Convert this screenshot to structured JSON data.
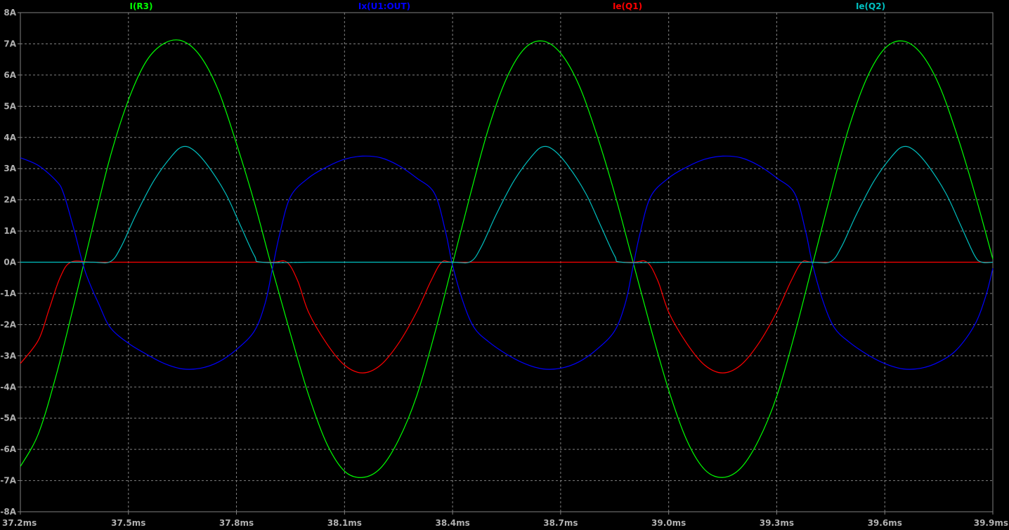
{
  "chart_data": {
    "type": "line",
    "background": "#000000",
    "grid": true,
    "grid_color": "#808080",
    "axis_color": "#808080",
    "tick_label_color": "#b0b0b0",
    "legend_placement": "top",
    "xlim": [
      37.2,
      39.9
    ],
    "ylim": [
      -8,
      8
    ],
    "x_unit": "ms",
    "y_unit": "A",
    "x_ticks": [
      "37.2ms",
      "37.5ms",
      "37.8ms",
      "38.1ms",
      "38.4ms",
      "38.7ms",
      "39.0ms",
      "39.3ms",
      "39.6ms",
      "39.9ms"
    ],
    "y_ticks": [
      "8A",
      "7A",
      "6A",
      "5A",
      "4A",
      "3A",
      "2A",
      "1A",
      "0A",
      "-1A",
      "-2A",
      "-3A",
      "-4A",
      "-5A",
      "-6A",
      "-7A",
      "-8A"
    ],
    "series": [
      {
        "name": "I(R3)",
        "color": "#00ff00",
        "points": [
          [
            37.2,
            -6.55
          ],
          [
            37.25,
            -5.5
          ],
          [
            37.3,
            -3.6
          ],
          [
            37.35,
            -1.3
          ],
          [
            37.4,
            1.1
          ],
          [
            37.45,
            3.4
          ],
          [
            37.5,
            5.2
          ],
          [
            37.55,
            6.45
          ],
          [
            37.6,
            7.02
          ],
          [
            37.65,
            7.09
          ],
          [
            37.7,
            6.6
          ],
          [
            37.75,
            5.5
          ],
          [
            37.8,
            3.8
          ],
          [
            37.85,
            1.9
          ],
          [
            37.9,
            -0.25
          ],
          [
            37.95,
            -2.3
          ],
          [
            38.0,
            -4.25
          ],
          [
            38.05,
            -5.8
          ],
          [
            38.1,
            -6.7
          ],
          [
            38.15,
            -6.9
          ],
          [
            38.2,
            -6.6
          ],
          [
            38.25,
            -5.7
          ],
          [
            38.3,
            -4.3
          ],
          [
            38.35,
            -2.3
          ],
          [
            38.4,
            -0.05
          ],
          [
            38.45,
            2.2
          ],
          [
            38.5,
            4.3
          ],
          [
            38.55,
            5.9
          ],
          [
            38.6,
            6.85
          ],
          [
            38.65,
            7.09
          ],
          [
            38.7,
            6.7
          ],
          [
            38.75,
            5.7
          ],
          [
            38.8,
            4.1
          ],
          [
            38.85,
            2.2
          ],
          [
            38.9,
            0.05
          ],
          [
            38.95,
            -2.1
          ],
          [
            39.0,
            -4.1
          ],
          [
            39.05,
            -5.7
          ],
          [
            39.1,
            -6.65
          ],
          [
            39.15,
            -6.9
          ],
          [
            39.2,
            -6.6
          ],
          [
            39.25,
            -5.7
          ],
          [
            39.3,
            -4.3
          ],
          [
            39.35,
            -2.3
          ],
          [
            39.4,
            -0.05
          ],
          [
            39.45,
            2.2
          ],
          [
            39.5,
            4.3
          ],
          [
            39.55,
            5.9
          ],
          [
            39.6,
            6.85
          ],
          [
            39.65,
            7.09
          ],
          [
            39.7,
            6.7
          ],
          [
            39.75,
            5.7
          ],
          [
            39.8,
            4.1
          ],
          [
            39.85,
            2.2
          ],
          [
            39.9,
            0.1
          ]
        ]
      },
      {
        "name": "Ix(U1:OUT)",
        "color": "#0000ff",
        "points": [
          [
            37.2,
            3.35
          ],
          [
            37.25,
            3.1
          ],
          [
            37.3,
            2.6
          ],
          [
            37.32,
            2.2
          ],
          [
            37.35,
            1.0
          ],
          [
            37.38,
            -0.3
          ],
          [
            37.42,
            -1.4
          ],
          [
            37.45,
            -2.1
          ],
          [
            37.5,
            -2.6
          ],
          [
            37.55,
            -2.95
          ],
          [
            37.6,
            -3.25
          ],
          [
            37.65,
            -3.42
          ],
          [
            37.7,
            -3.4
          ],
          [
            37.75,
            -3.2
          ],
          [
            37.8,
            -2.8
          ],
          [
            37.85,
            -2.2
          ],
          [
            37.88,
            -1.3
          ],
          [
            37.9,
            -0.2
          ],
          [
            37.92,
            0.9
          ],
          [
            37.95,
            2.1
          ],
          [
            38.0,
            2.7
          ],
          [
            38.05,
            3.05
          ],
          [
            38.1,
            3.3
          ],
          [
            38.15,
            3.4
          ],
          [
            38.2,
            3.35
          ],
          [
            38.25,
            3.1
          ],
          [
            38.3,
            2.7
          ],
          [
            38.35,
            2.2
          ],
          [
            38.38,
            1.0
          ],
          [
            38.4,
            -0.1
          ],
          [
            38.43,
            -1.3
          ],
          [
            38.46,
            -2.1
          ],
          [
            38.5,
            -2.55
          ],
          [
            38.55,
            -2.95
          ],
          [
            38.6,
            -3.25
          ],
          [
            38.65,
            -3.42
          ],
          [
            38.7,
            -3.4
          ],
          [
            38.75,
            -3.2
          ],
          [
            38.8,
            -2.8
          ],
          [
            38.85,
            -2.2
          ],
          [
            38.88,
            -1.3
          ],
          [
            38.9,
            -0.2
          ],
          [
            38.92,
            0.9
          ],
          [
            38.95,
            2.1
          ],
          [
            39.0,
            2.7
          ],
          [
            39.05,
            3.05
          ],
          [
            39.1,
            3.3
          ],
          [
            39.15,
            3.4
          ],
          [
            39.2,
            3.35
          ],
          [
            39.25,
            3.1
          ],
          [
            39.3,
            2.7
          ],
          [
            39.35,
            2.2
          ],
          [
            39.38,
            1.0
          ],
          [
            39.4,
            -0.1
          ],
          [
            39.43,
            -1.3
          ],
          [
            39.46,
            -2.1
          ],
          [
            39.5,
            -2.55
          ],
          [
            39.55,
            -2.95
          ],
          [
            39.6,
            -3.25
          ],
          [
            39.65,
            -3.42
          ],
          [
            39.7,
            -3.4
          ],
          [
            39.75,
            -3.2
          ],
          [
            39.8,
            -2.8
          ],
          [
            39.85,
            -2.0
          ],
          [
            39.88,
            -1.1
          ],
          [
            39.9,
            -0.2
          ]
        ]
      },
      {
        "name": "Ie(Q1)",
        "color": "#ff0000",
        "points": [
          [
            37.2,
            -3.25
          ],
          [
            37.25,
            -2.5
          ],
          [
            37.28,
            -1.5
          ],
          [
            37.31,
            -0.5
          ],
          [
            37.34,
            0.0
          ],
          [
            37.4,
            0.0
          ],
          [
            37.5,
            0.0
          ],
          [
            37.6,
            0.0
          ],
          [
            37.7,
            0.0
          ],
          [
            37.8,
            0.0
          ],
          [
            37.9,
            0.0
          ],
          [
            37.94,
            0.0
          ],
          [
            37.97,
            -0.6
          ],
          [
            38.0,
            -1.6
          ],
          [
            38.05,
            -2.6
          ],
          [
            38.1,
            -3.3
          ],
          [
            38.15,
            -3.55
          ],
          [
            38.2,
            -3.3
          ],
          [
            38.25,
            -2.6
          ],
          [
            38.3,
            -1.6
          ],
          [
            38.34,
            -0.6
          ],
          [
            38.37,
            0.0
          ],
          [
            38.4,
            0.0
          ],
          [
            38.5,
            0.0
          ],
          [
            38.6,
            0.0
          ],
          [
            38.7,
            0.0
          ],
          [
            38.8,
            0.0
          ],
          [
            38.9,
            0.0
          ],
          [
            38.94,
            0.0
          ],
          [
            38.97,
            -0.6
          ],
          [
            39.0,
            -1.6
          ],
          [
            39.05,
            -2.6
          ],
          [
            39.1,
            -3.3
          ],
          [
            39.15,
            -3.55
          ],
          [
            39.2,
            -3.3
          ],
          [
            39.25,
            -2.6
          ],
          [
            39.3,
            -1.6
          ],
          [
            39.34,
            -0.6
          ],
          [
            39.37,
            0.0
          ],
          [
            39.4,
            0.0
          ],
          [
            39.5,
            0.0
          ],
          [
            39.6,
            0.0
          ],
          [
            39.7,
            0.0
          ],
          [
            39.8,
            0.0
          ],
          [
            39.9,
            0.0
          ]
        ]
      },
      {
        "name": "Ie(Q2)",
        "color": "#00c0c0",
        "points": [
          [
            37.2,
            0.0
          ],
          [
            37.3,
            0.0
          ],
          [
            37.4,
            0.0
          ],
          [
            37.45,
            0.02
          ],
          [
            37.48,
            0.5
          ],
          [
            37.52,
            1.5
          ],
          [
            37.57,
            2.6
          ],
          [
            37.62,
            3.4
          ],
          [
            37.65,
            3.7
          ],
          [
            37.68,
            3.6
          ],
          [
            37.72,
            3.1
          ],
          [
            37.77,
            2.2
          ],
          [
            37.81,
            1.2
          ],
          [
            37.85,
            0.2
          ],
          [
            37.87,
            0.0
          ],
          [
            38.0,
            0.0
          ],
          [
            38.1,
            0.0
          ],
          [
            38.2,
            0.0
          ],
          [
            38.3,
            0.0
          ],
          [
            38.4,
            0.0
          ],
          [
            38.45,
            0.02
          ],
          [
            38.48,
            0.5
          ],
          [
            38.52,
            1.5
          ],
          [
            38.57,
            2.6
          ],
          [
            38.62,
            3.4
          ],
          [
            38.65,
            3.7
          ],
          [
            38.68,
            3.6
          ],
          [
            38.72,
            3.1
          ],
          [
            38.77,
            2.2
          ],
          [
            38.81,
            1.2
          ],
          [
            38.85,
            0.2
          ],
          [
            38.87,
            0.0
          ],
          [
            39.0,
            0.0
          ],
          [
            39.1,
            0.0
          ],
          [
            39.2,
            0.0
          ],
          [
            39.3,
            0.0
          ],
          [
            39.4,
            0.0
          ],
          [
            39.45,
            0.02
          ],
          [
            39.48,
            0.5
          ],
          [
            39.52,
            1.5
          ],
          [
            39.57,
            2.6
          ],
          [
            39.62,
            3.4
          ],
          [
            39.65,
            3.7
          ],
          [
            39.68,
            3.6
          ],
          [
            39.72,
            3.1
          ],
          [
            39.77,
            2.2
          ],
          [
            39.81,
            1.2
          ],
          [
            39.85,
            0.2
          ],
          [
            39.87,
            0.0
          ],
          [
            39.9,
            0.0
          ]
        ]
      }
    ]
  }
}
